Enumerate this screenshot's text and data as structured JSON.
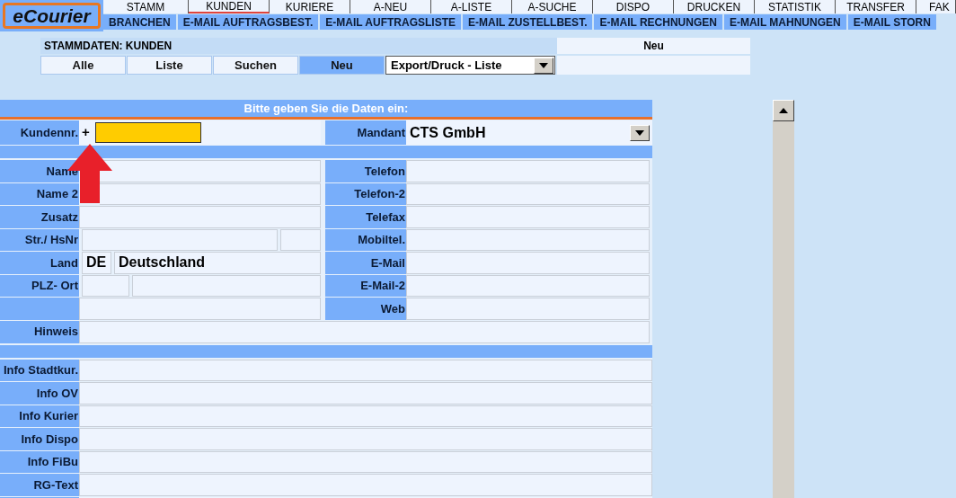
{
  "logo": "eCourier",
  "menu_main": [
    {
      "label": "STAMM",
      "selected": false
    },
    {
      "label": "KUNDEN",
      "selected": true
    },
    {
      "label": "KURIERE",
      "selected": false
    },
    {
      "label": "A-NEU",
      "selected": false
    },
    {
      "label": "A-LISTE",
      "selected": false
    },
    {
      "label": "A-SUCHE",
      "selected": false
    },
    {
      "label": "DISPO",
      "selected": false
    },
    {
      "label": "DRUCKEN",
      "selected": false
    },
    {
      "label": "STATISTIK",
      "selected": false
    },
    {
      "label": "TRANSFER",
      "selected": false
    },
    {
      "label": "FAK",
      "selected": false
    }
  ],
  "menu_sub": [
    "BRANCHEN",
    "E-MAIL AUFTRAGSBEST.",
    "E-MAIL AUFTRAGSLISTE",
    "E-MAIL ZUSTELLBEST.",
    "E-MAIL RECHNUNGEN",
    "E-MAIL MAHNUNGEN",
    "E-MAIL STORN"
  ],
  "section": {
    "title": "STAMMDATEN: KUNDEN",
    "mode": "Neu"
  },
  "actions": [
    {
      "label": "Alle",
      "selected": false
    },
    {
      "label": "Liste",
      "selected": false
    },
    {
      "label": "Suchen",
      "selected": false
    },
    {
      "label": "Neu",
      "selected": true
    }
  ],
  "export_select": "Export/Druck - Liste",
  "form": {
    "title": "Bitte geben Sie die Daten ein:",
    "customer_no": {
      "label": "Kundennr.",
      "prefix": "+"
    },
    "mandant": {
      "label": "Mandant",
      "value": "CTS GmbH"
    },
    "rows": [
      {
        "left": {
          "label": "Name",
          "kind": "single"
        },
        "right": "Telefon"
      },
      {
        "left": {
          "label": "Name 2",
          "kind": "single"
        },
        "right": "Telefon-2"
      },
      {
        "left": {
          "label": "Zusatz",
          "kind": "single"
        },
        "right": "Telefax"
      },
      {
        "left": {
          "label": "Str./ HsNr",
          "kind": "street"
        },
        "right": "Mobiltel."
      },
      {
        "left": {
          "label": "Land",
          "kind": "country",
          "code": "DE",
          "value": "Deutschland"
        },
        "right": "E-Mail"
      },
      {
        "left": {
          "label": "PLZ- Ort",
          "kind": "zip"
        },
        "right": "E-Mail-2"
      },
      {
        "left": {
          "kind": "single"
        },
        "right": "Web"
      }
    ],
    "hint": "Hinweis",
    "info_rows": [
      "Info Stadtkur.",
      "Info OV",
      "Info Kurier",
      "Info Dispo",
      "Info FiBu",
      "RG-Text"
    ]
  }
}
